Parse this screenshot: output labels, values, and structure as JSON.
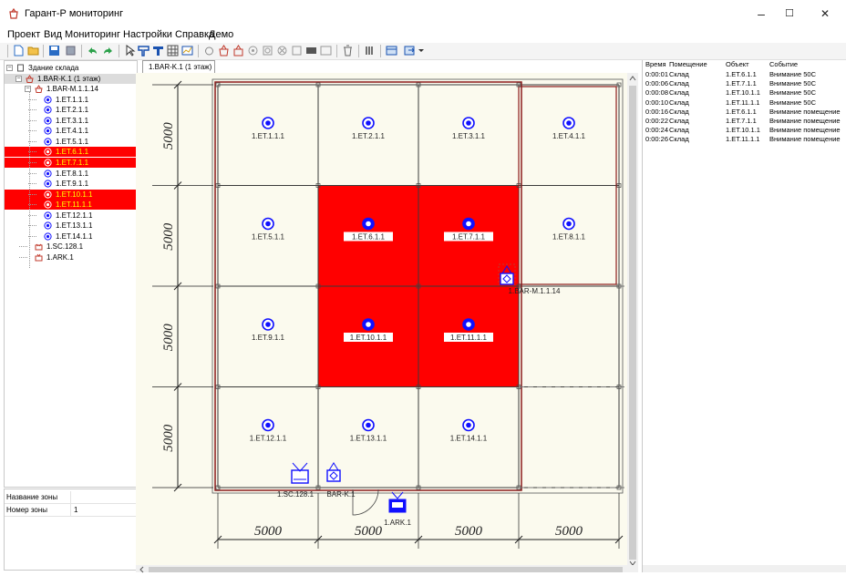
{
  "window": {
    "title": "Гарант-Р мониторинг",
    "minimize": "–",
    "maximize": "☐",
    "close": "✕"
  },
  "menu": [
    "Проект",
    "Вид",
    "Мониторинг",
    "Настройки",
    "Справка",
    "Демо"
  ],
  "tree": {
    "root": "Здание склада",
    "floor": "1.BAR-K.1 (1 этаж)",
    "barm": "1.BAR-M.1.1.14",
    "sensors": [
      {
        "label": "1.ET.1.1.1",
        "alarm": false
      },
      {
        "label": "1.ET.2.1.1",
        "alarm": false
      },
      {
        "label": "1.ET.3.1.1",
        "alarm": false
      },
      {
        "label": "1.ET.4.1.1",
        "alarm": false
      },
      {
        "label": "1.ET.5.1.1",
        "alarm": false
      },
      {
        "label": "1.ET.6.1.1",
        "alarm": true
      },
      {
        "label": "1.ET.7.1.1",
        "alarm": true
      },
      {
        "label": "1.ET.8.1.1",
        "alarm": false
      },
      {
        "label": "1.ET.9.1.1",
        "alarm": false
      },
      {
        "label": "1.ET.10.1.1",
        "alarm": true
      },
      {
        "label": "1.ET.11.1.1",
        "alarm": true
      },
      {
        "label": "1.ET.12.1.1",
        "alarm": false
      },
      {
        "label": "1.ET.13.1.1",
        "alarm": false
      },
      {
        "label": "1.ET.14.1.1",
        "alarm": false
      }
    ],
    "sc": "1.SC.128.1",
    "ark": "1.ARK.1"
  },
  "properties": [
    {
      "key": "Название зоны",
      "value": ""
    },
    {
      "key": "Номер зоны",
      "value": "1"
    }
  ],
  "tab": "1.BAR-K.1 (1 этаж)",
  "plan": {
    "cells": [
      {
        "label": "1.ET.1.1.1",
        "alarm": false
      },
      {
        "label": "1.ET.2.1.1",
        "alarm": false
      },
      {
        "label": "1.ET.3.1.1",
        "alarm": false
      },
      {
        "label": "1.ET.4.1.1",
        "alarm": false
      },
      {
        "label": "1.ET.5.1.1",
        "alarm": false
      },
      {
        "label": "1.ET.6.1.1",
        "alarm": true
      },
      {
        "label": "1.ET.7.1.1",
        "alarm": true
      },
      {
        "label": "1.ET.8.1.1",
        "alarm": false
      },
      {
        "label": "1.ET.9.1.1",
        "alarm": false
      },
      {
        "label": "1.ET.10.1.1",
        "alarm": true
      },
      {
        "label": "1.ET.11.1.1",
        "alarm": true
      },
      {
        "label": "",
        "alarm": false
      },
      {
        "label": "1.ET.12.1.1",
        "alarm": false
      },
      {
        "label": "1.ET.13.1.1",
        "alarm": false
      },
      {
        "label": "1.ET.14.1.1",
        "alarm": false
      },
      {
        "label": "",
        "alarm": false
      }
    ],
    "row_dims": [
      "5000",
      "5000",
      "5000",
      "5000"
    ],
    "col_dims": [
      "5000",
      "5000",
      "5000",
      "5000"
    ],
    "barm_label": "1.BAR-M.1.1.14",
    "sc_label": "1.SC.128.1",
    "bark_label": "BAR-K.1",
    "ark_label": "1.ARK.1",
    "alarm_color": "#ff0000",
    "wall_color": "#8b1a1a",
    "sensor_color": "#1010ff"
  },
  "log": {
    "columns": [
      "Время",
      "Помещение",
      "Объект",
      "Событие"
    ],
    "rows": [
      [
        "0:00:01",
        "Склад",
        "1.ET.6.1.1",
        "Внимание 50С"
      ],
      [
        "0:00:06",
        "Склад",
        "1.ET.7.1.1",
        "Внимание 50С"
      ],
      [
        "0:00:08",
        "Склад",
        "1.ET.10.1.1",
        "Внимание 50С"
      ],
      [
        "0:00:10",
        "Склад",
        "1.ET.11.1.1",
        "Внимание 50С"
      ],
      [
        "0:00:16",
        "Склад",
        "1.ET.6.1.1",
        "Внимание помещение"
      ],
      [
        "0:00:22",
        "Склад",
        "1.ET.7.1.1",
        "Внимание помещение"
      ],
      [
        "0:00:24",
        "Склад",
        "1.ET.10.1.1",
        "Внимание помещение"
      ],
      [
        "0:00:26",
        "Склад",
        "1.ET.11.1.1",
        "Внимание помещение"
      ]
    ]
  }
}
